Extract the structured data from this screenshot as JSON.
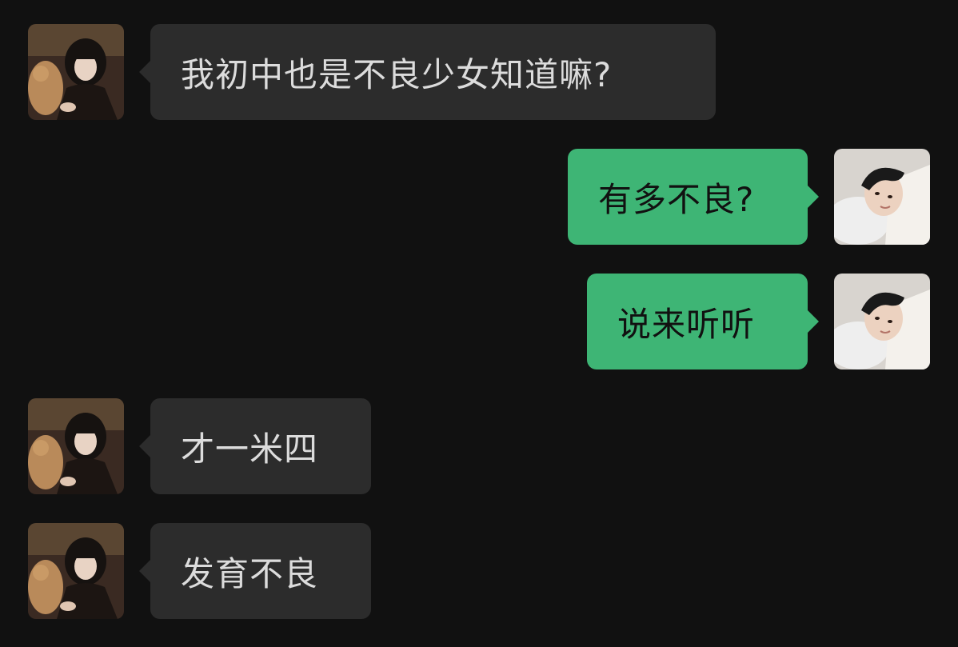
{
  "chat": {
    "theme": "dark",
    "colors": {
      "background": "#111111",
      "incoming_bubble": "#2c2c2c",
      "outgoing_bubble": "#3eb575"
    },
    "messages": [
      {
        "sender": "other",
        "avatar": "girl-avatar",
        "text": "我初中也是不良少女知道嘛?"
      },
      {
        "sender": "self",
        "avatar": "boy-avatar",
        "text": "有多不良?"
      },
      {
        "sender": "self",
        "avatar": "boy-avatar",
        "text": "说来听听"
      },
      {
        "sender": "other",
        "avatar": "girl-avatar",
        "text": "才一米四"
      },
      {
        "sender": "other",
        "avatar": "girl-avatar",
        "text": "发育不良"
      }
    ]
  }
}
